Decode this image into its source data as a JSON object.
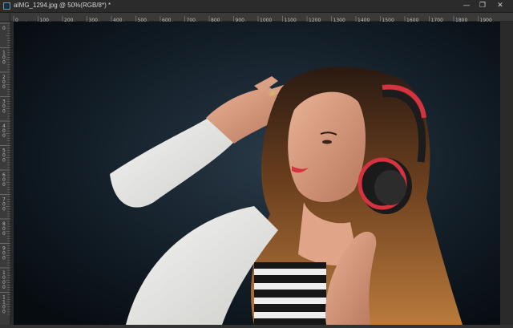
{
  "window": {
    "title": "aIMG_1294.jpg @ 50%(RGB/8*) *",
    "minimize": "—",
    "restore": "❐",
    "close": "✕"
  },
  "ruler": {
    "horizontal_labels": [
      "0",
      "100",
      "200",
      "300",
      "400",
      "500",
      "600",
      "700",
      "800",
      "900",
      "1000",
      "1100",
      "1200",
      "1300",
      "1400",
      "1500",
      "1600",
      "1700",
      "1800",
      "1900"
    ],
    "vertical_labels": [
      "0",
      "100",
      "200",
      "300",
      "400",
      "500",
      "600",
      "700",
      "800",
      "900",
      "1000",
      "1100"
    ]
  },
  "photo": {
    "subject": "woman-with-red-headphones",
    "background_color": "#0f1a22",
    "accent_color": "#d4333f"
  },
  "icons": {
    "app_logo": "photoshop-logo-icon"
  }
}
